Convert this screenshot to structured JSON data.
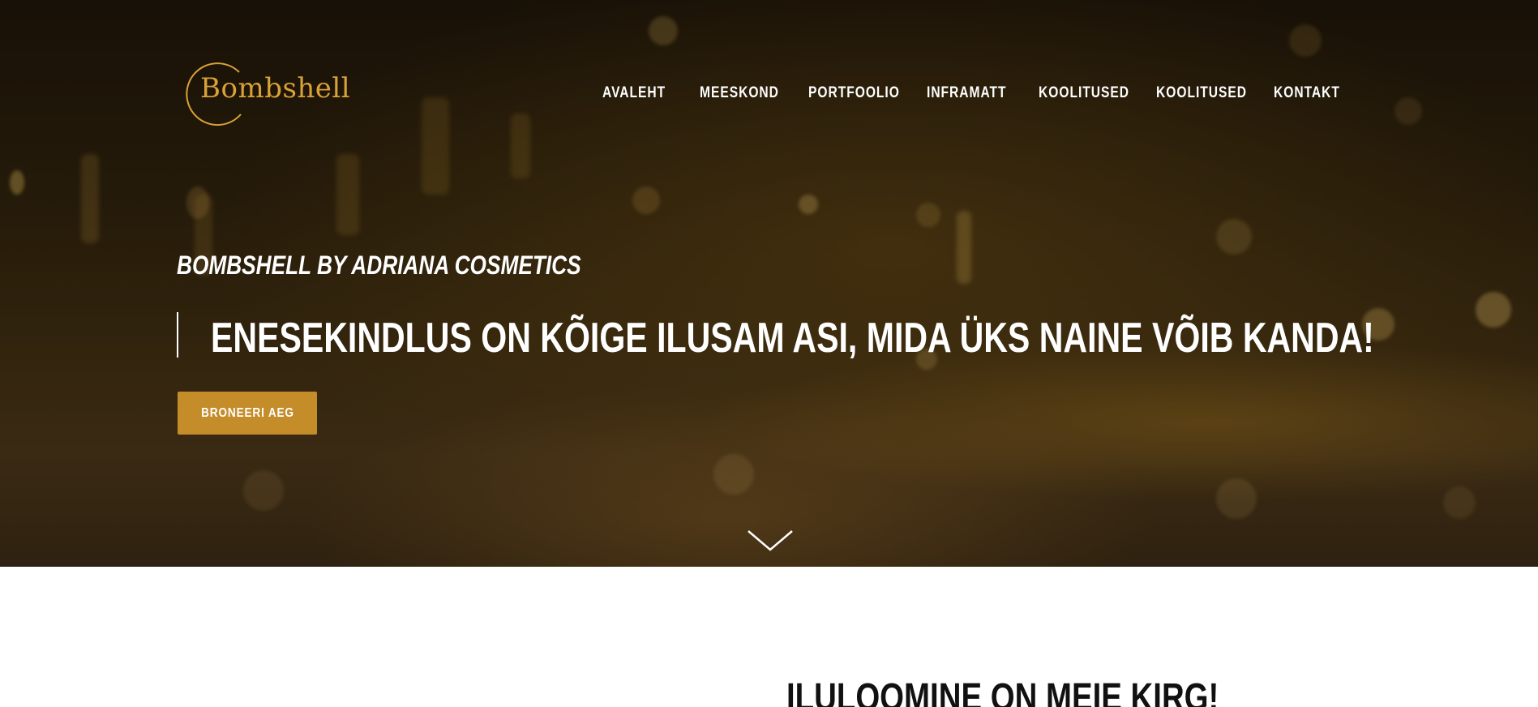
{
  "header": {
    "logo_text": "Bombshell",
    "nav": [
      {
        "label": "AVALEHT"
      },
      {
        "label": "MEESKOND"
      },
      {
        "label": "PORTFOOLIO"
      },
      {
        "label": "INFRAMATT"
      },
      {
        "label": "KOOLITUSED"
      },
      {
        "label": "KOOLITUSED"
      },
      {
        "label": "KONTAKT"
      }
    ]
  },
  "hero": {
    "subtitle": "BOMBSHELL BY ADRIANA COSMETICS",
    "headline": "ENESEKINDLUS ON KÕIGE ILUSAM ASI, MIDA ÜKS NAINE VÕIB KANDA!",
    "cta_label": "BRONEERI AEG",
    "scroll_icon": "chevron-down-icon"
  },
  "next_section": {
    "title": "ILULOOMINE ON MEIE KIRG!"
  },
  "colors": {
    "accent": "#c58c2a",
    "logo_gold": "#d9a237",
    "hero_dark": "#1c1408",
    "text_light": "#ffffff",
    "text_dark": "#111111"
  }
}
